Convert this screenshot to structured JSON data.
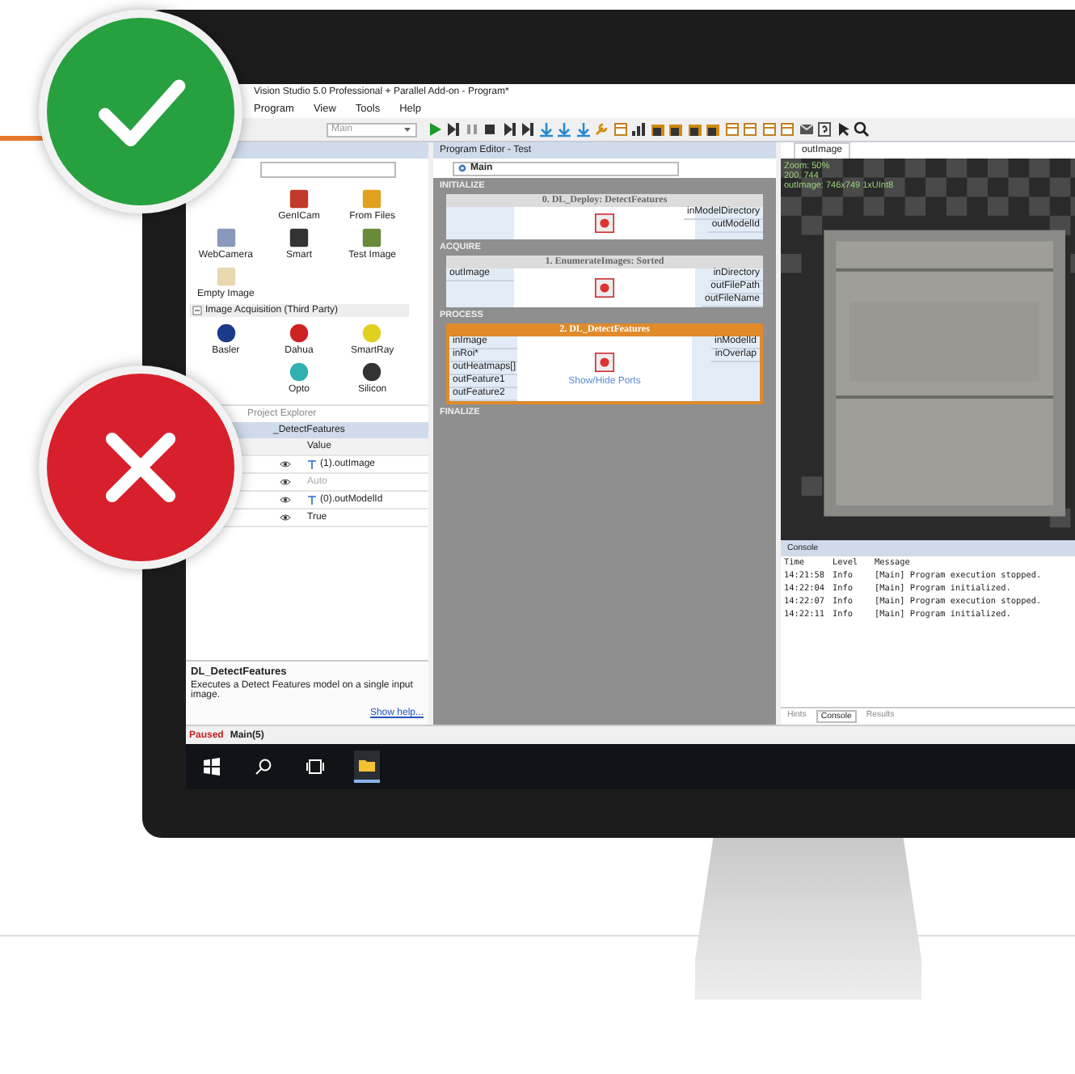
{
  "window": {
    "title": "Vision Studio 5.0 Professional + Parallel Add-on - Program*"
  },
  "menu": [
    "Program",
    "View",
    "Tools",
    "Help"
  ],
  "toolbar": {
    "program_combo": "Main"
  },
  "toolbox": {
    "tiles": [
      {
        "label": "GenICam"
      },
      {
        "label": "From Files"
      },
      {
        "label": "WebCamera"
      },
      {
        "label": "Smart"
      },
      {
        "label": "Test Image"
      },
      {
        "label": "Empty Image"
      }
    ],
    "section": "Image Acquisition (Third Party)",
    "tiles_third_party": [
      {
        "label": "Basler"
      },
      {
        "label": "Dahua"
      },
      {
        "label": "SmartRay"
      },
      {
        "label": "Opto"
      },
      {
        "label": "Silicon"
      }
    ],
    "tab": "Project Explorer"
  },
  "properties": {
    "title": "_DetectFeatures",
    "header": "Value",
    "rows": [
      {
        "value": "(1).outImage",
        "linked": true,
        "disabled": false
      },
      {
        "value": "Auto",
        "linked": false,
        "disabled": true
      },
      {
        "value": "(0).outModelId",
        "linked": true,
        "disabled": false
      },
      {
        "value": "True",
        "linked": false,
        "disabled": false
      }
    ]
  },
  "help": {
    "title": "DL_DetectFeatures",
    "text": "Executes a Detect Features model on a single input image.",
    "link": "Show help..."
  },
  "status": {
    "state": "Paused",
    "program": "Main(5)"
  },
  "editor": {
    "title": "Program Editor - Test",
    "combo": "Main",
    "sections": [
      {
        "name": "INITIALIZE",
        "blocks": [
          {
            "title": "0. DL_Deploy: DetectFeatures",
            "right": [
              "inModelDirectory",
              "outModelId"
            ],
            "selected": false
          }
        ]
      },
      {
        "name": "ACQUIRE",
        "blocks": [
          {
            "title": "1. EnumerateImages: Sorted",
            "left": [
              "outImage"
            ],
            "right": [
              "inDirectory",
              "outFilePath",
              "outFileName"
            ],
            "selected": false
          }
        ]
      },
      {
        "name": "PROCESS",
        "blocks": [
          {
            "title": "2. DL_DetectFeatures",
            "left": [
              "inImage",
              "inRoi*",
              "outHeatmaps[]",
              "outFeature1",
              "outFeature2"
            ],
            "right": [
              "inModelId",
              "inOverlap"
            ],
            "selected": true,
            "link": "Show/Hide Ports"
          }
        ]
      },
      {
        "name": "FINALIZE"
      }
    ]
  },
  "image_view": {
    "tab": "outImage",
    "zoom": "Zoom: 50%",
    "coords": "200, 744",
    "info": "outImage: 746x749 1xUInt8"
  },
  "console": {
    "title": "Console",
    "columns": [
      "Time",
      "Level",
      "Message"
    ],
    "rows": [
      [
        "14:21:58",
        "Info",
        "[Main] Program execution stopped."
      ],
      [
        "14:22:04",
        "Info",
        "[Main] Program initialized."
      ],
      [
        "14:22:07",
        "Info",
        "[Main] Program execution stopped."
      ],
      [
        "14:22:11",
        "Info",
        "[Main] Program initialized."
      ]
    ],
    "tabs": [
      {
        "label": "Hints",
        "selected": false
      },
      {
        "label": "Console",
        "selected": true
      },
      {
        "label": "Results",
        "selected": false
      }
    ]
  },
  "taskbar": [
    {
      "kind": "start",
      "selected": false
    },
    {
      "kind": "search",
      "selected": false
    },
    {
      "kind": "taskview",
      "selected": false
    },
    {
      "kind": "folder",
      "selected": true
    }
  ],
  "badges": [
    {
      "kind": "check"
    },
    {
      "kind": "cross"
    }
  ]
}
